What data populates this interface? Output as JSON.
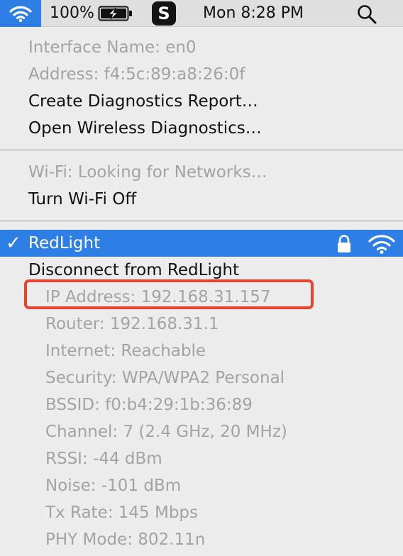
{
  "menubar": {
    "wifi_icon": "wifi-icon",
    "battery_percent": "100%",
    "battery_icon": "battery-charging-icon",
    "app_icon_letter": "S",
    "clock": "Mon 8:28 PM",
    "search_icon": "magnifier-icon"
  },
  "menu": {
    "info": {
      "interface_name": "Interface Name: en0",
      "address": "Address: f4:5c:89:a8:26:0f"
    },
    "actions": {
      "create_report": "Create Diagnostics Report…",
      "open_diagnostics": "Open Wireless Diagnostics…"
    },
    "wifi_status": "Wi-Fi: Looking for Networks…",
    "turn_off": "Turn Wi-Fi Off",
    "network": {
      "checkmark": "✓",
      "name": "RedLight",
      "lock_icon": "lock-icon",
      "signal_icon": "wifi-signal-icon",
      "disconnect": "Disconnect from RedLight",
      "details": [
        "IP Address: 192.168.31.157",
        "Router: 192.168.31.1",
        "Internet: Reachable",
        "Security: WPA/WPA2 Personal",
        "BSSID: f0:b4:29:1b:36:89",
        "Channel: 7 (2.4 GHz, 20 MHz)",
        "RSSI: -44 dBm",
        "Noise: -101 dBm",
        "Tx Rate: 145 Mbps",
        "PHY Mode: 802.11n"
      ]
    }
  },
  "colors": {
    "selection_blue": "#2d7fe6",
    "annotation_red": "#e8432e",
    "disabled_text": "#a3a3a3"
  }
}
